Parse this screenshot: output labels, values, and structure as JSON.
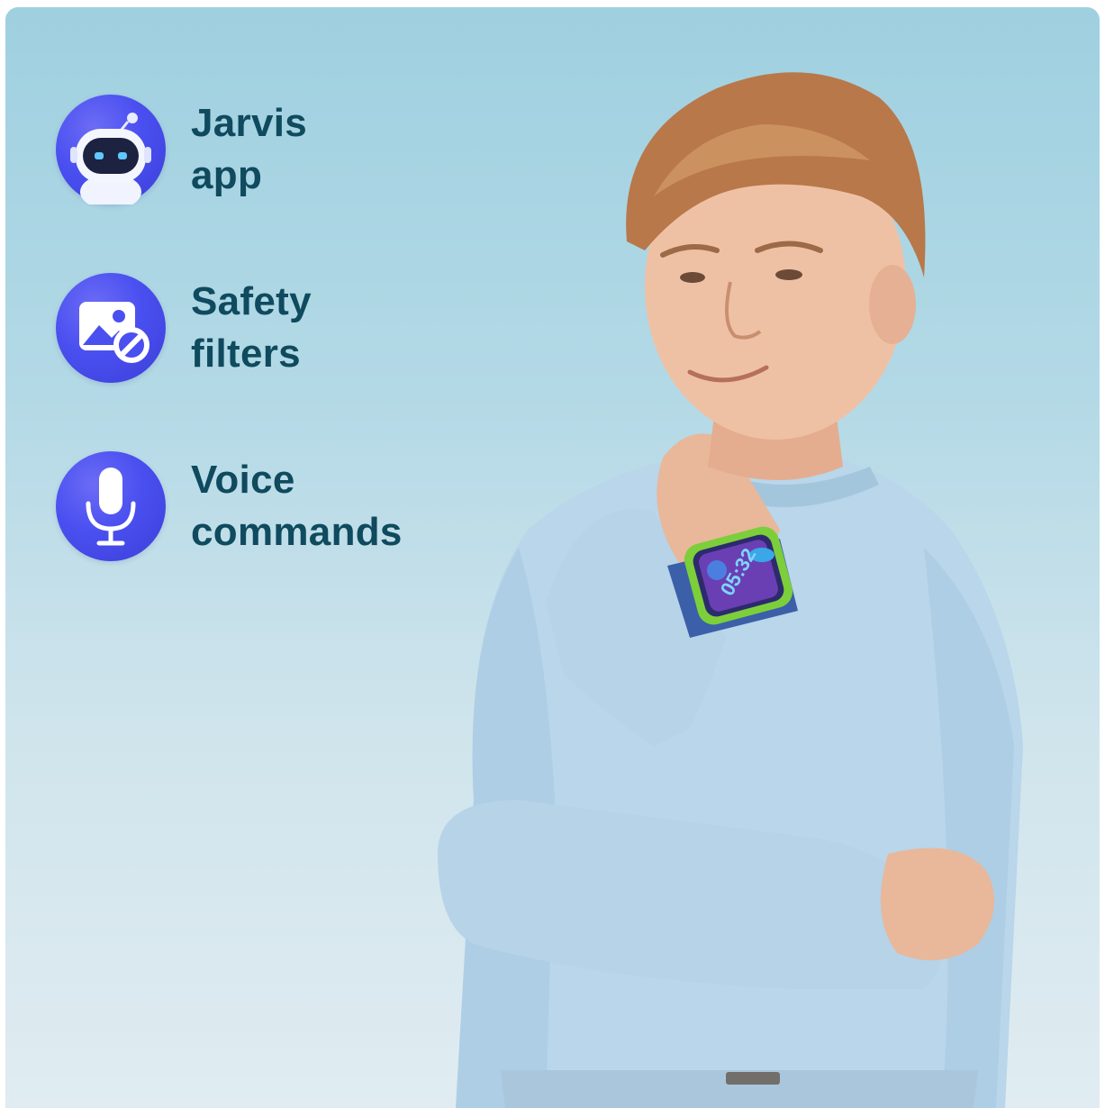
{
  "features": [
    {
      "line1": "Jarvis",
      "line2": "app",
      "icon": "robot-icon"
    },
    {
      "line1": "Safety",
      "line2": "filters",
      "icon": "image-blocked-icon"
    },
    {
      "line1": "Voice",
      "line2": "commands",
      "icon": "microphone-icon"
    }
  ],
  "watch": {
    "time": "05:32"
  },
  "colors": {
    "text": "#0f4a5e",
    "icon_bg": "#4a4ff0",
    "sweater": "#b9d6ea",
    "watch_band": "#7ccf3a"
  }
}
